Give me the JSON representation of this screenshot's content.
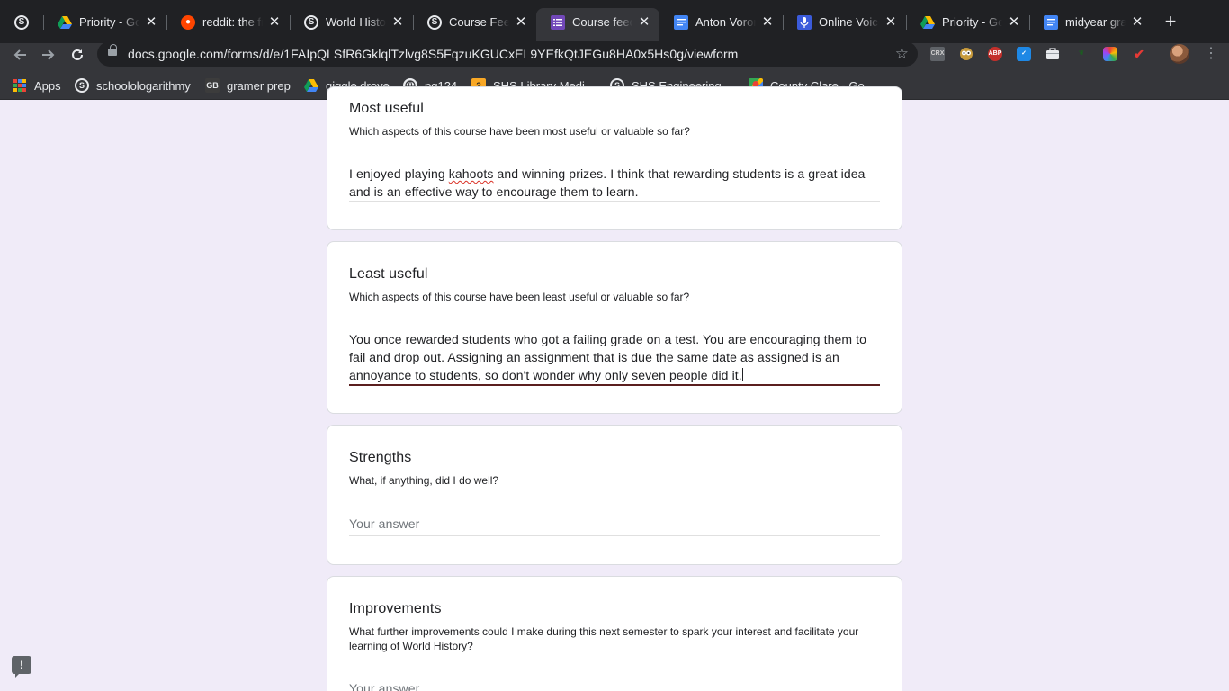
{
  "browser": {
    "tabs": [
      {
        "title": "",
        "icon": "schoology-icon",
        "active": false
      },
      {
        "title": "Priority - Go",
        "icon": "google-drive-icon",
        "active": false
      },
      {
        "title": "reddit: the fr",
        "icon": "reddit-icon",
        "active": false
      },
      {
        "title": "World Histor",
        "icon": "schoology-icon",
        "active": false
      },
      {
        "title": "Course Feed",
        "icon": "schoology-icon",
        "active": false
      },
      {
        "title": "Course feedb",
        "icon": "google-forms-icon",
        "active": true
      },
      {
        "title": "Anton Vorono",
        "icon": "google-docs-icon",
        "active": false
      },
      {
        "title": "Online Voice",
        "icon": "voice-recorder-icon",
        "active": false
      },
      {
        "title": "Priority - Go",
        "icon": "google-drive-icon",
        "active": false
      },
      {
        "title": "midyear grad",
        "icon": "google-docs-icon",
        "active": false
      }
    ],
    "url": "docs.google.com/forms/d/e/1FAIpQLSfR6GklqlTzlvg8S5FqzuKGUCxEL9YEfkQtJEGu8HA0x5Hs0g/viewform",
    "bookmarks": [
      {
        "label": "Apps",
        "icon": "apps-grid-icon"
      },
      {
        "label": "schoolologarithmy",
        "icon": "schoology-icon"
      },
      {
        "label": "gramer prep",
        "icon": "gb-icon"
      },
      {
        "label": "giggle drove",
        "icon": "google-drive-icon"
      },
      {
        "label": "pg124",
        "icon": "globe-icon"
      },
      {
        "label": "SHS Library Medi...",
        "icon": "library-icon"
      },
      {
        "label": "SHS Engineering...",
        "icon": "schoology-icon"
      },
      {
        "label": "County Clare - Go...",
        "icon": "google-maps-icon"
      }
    ],
    "extensions": [
      "CRX",
      "ABP"
    ]
  },
  "form": {
    "questions": [
      {
        "title": "Most useful",
        "description": "Which aspects of this course have been most useful or valuable so far?",
        "answer_before": "I enjoyed playing ",
        "answer_misspelled": "kahoots",
        "answer_after": " and winning prizes. I think that rewarding students is a great idea and is an effective way to encourage them to learn."
      },
      {
        "title": "Least useful",
        "description": "Which aspects of this course have been least useful or valuable so far?",
        "answer": "You once rewarded students who got a failing grade on a test. You are encouraging them to fail and drop out. Assigning an assignment that is due the same date as assigned is an annoyance to students, so don't wonder why only seven people did it."
      },
      {
        "title": "Strengths",
        "description": "What, if anything, did I do well?",
        "placeholder": "Your answer"
      },
      {
        "title": "Improvements",
        "description": "What further improvements could I make during this next semester to spark your interest and facilitate your learning of World History?",
        "placeholder": "Your answer"
      }
    ]
  },
  "feedback_button": "!"
}
